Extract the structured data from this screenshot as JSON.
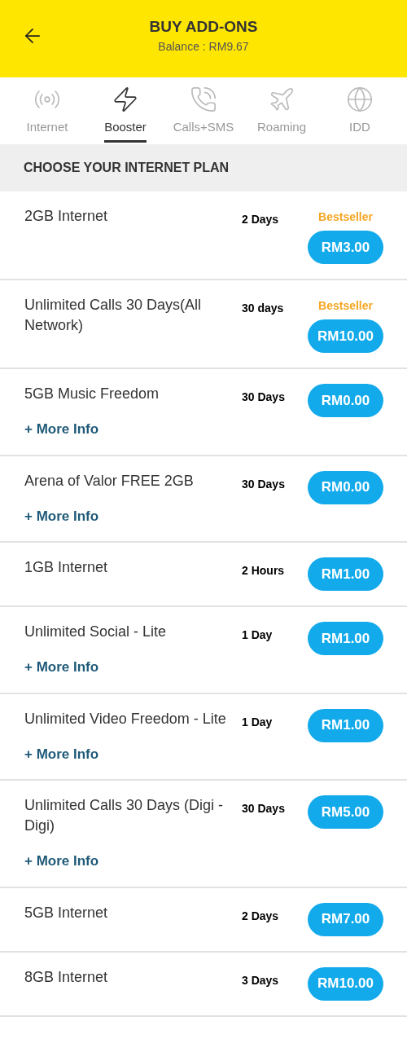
{
  "header": {
    "title": "BUY ADD-ONS",
    "balance": "Balance : RM9.67"
  },
  "tabs": [
    {
      "label": "Internet",
      "selected": false
    },
    {
      "label": "Booster",
      "selected": true
    },
    {
      "label": "Calls+SMS",
      "selected": false
    },
    {
      "label": "Roaming",
      "selected": false
    },
    {
      "label": "IDD",
      "selected": false
    }
  ],
  "section_title": "CHOOSE YOUR INTERNET PLAN",
  "plans": [
    {
      "name": "2GB Internet",
      "duration": "2 Days",
      "badge": "Bestseller",
      "price": "RM3.00"
    },
    {
      "name": "Unlimited Calls 30 Days(All Network)",
      "duration": "30 days",
      "badge": "Bestseller",
      "price": "RM10.00"
    },
    {
      "name": "5GB Music Freedom",
      "duration": "30 Days",
      "price": "RM0.00",
      "more_info": "+ More Info"
    },
    {
      "name": "Arena of Valor FREE 2GB",
      "duration": "30 Days",
      "price": "RM0.00",
      "more_info": "+ More Info"
    },
    {
      "name": "1GB Internet",
      "duration": "2 Hours",
      "price": "RM1.00"
    },
    {
      "name": "Unlimited Social - Lite",
      "duration": "1 Day",
      "price": "RM1.00",
      "more_info": "+ More Info"
    },
    {
      "name": "Unlimited Video Freedom - Lite",
      "duration": "1 Day",
      "price": "RM1.00",
      "more_info": "+ More Info"
    },
    {
      "name": "Unlimited Calls 30 Days (Digi - Digi)",
      "duration": "30 Days",
      "price": "RM5.00",
      "more_info": "+ More Info"
    },
    {
      "name": "5GB Internet",
      "duration": "2 Days",
      "price": "RM7.00"
    },
    {
      "name": "8GB Internet",
      "duration": "3 Days",
      "price": "RM10.00"
    }
  ]
}
